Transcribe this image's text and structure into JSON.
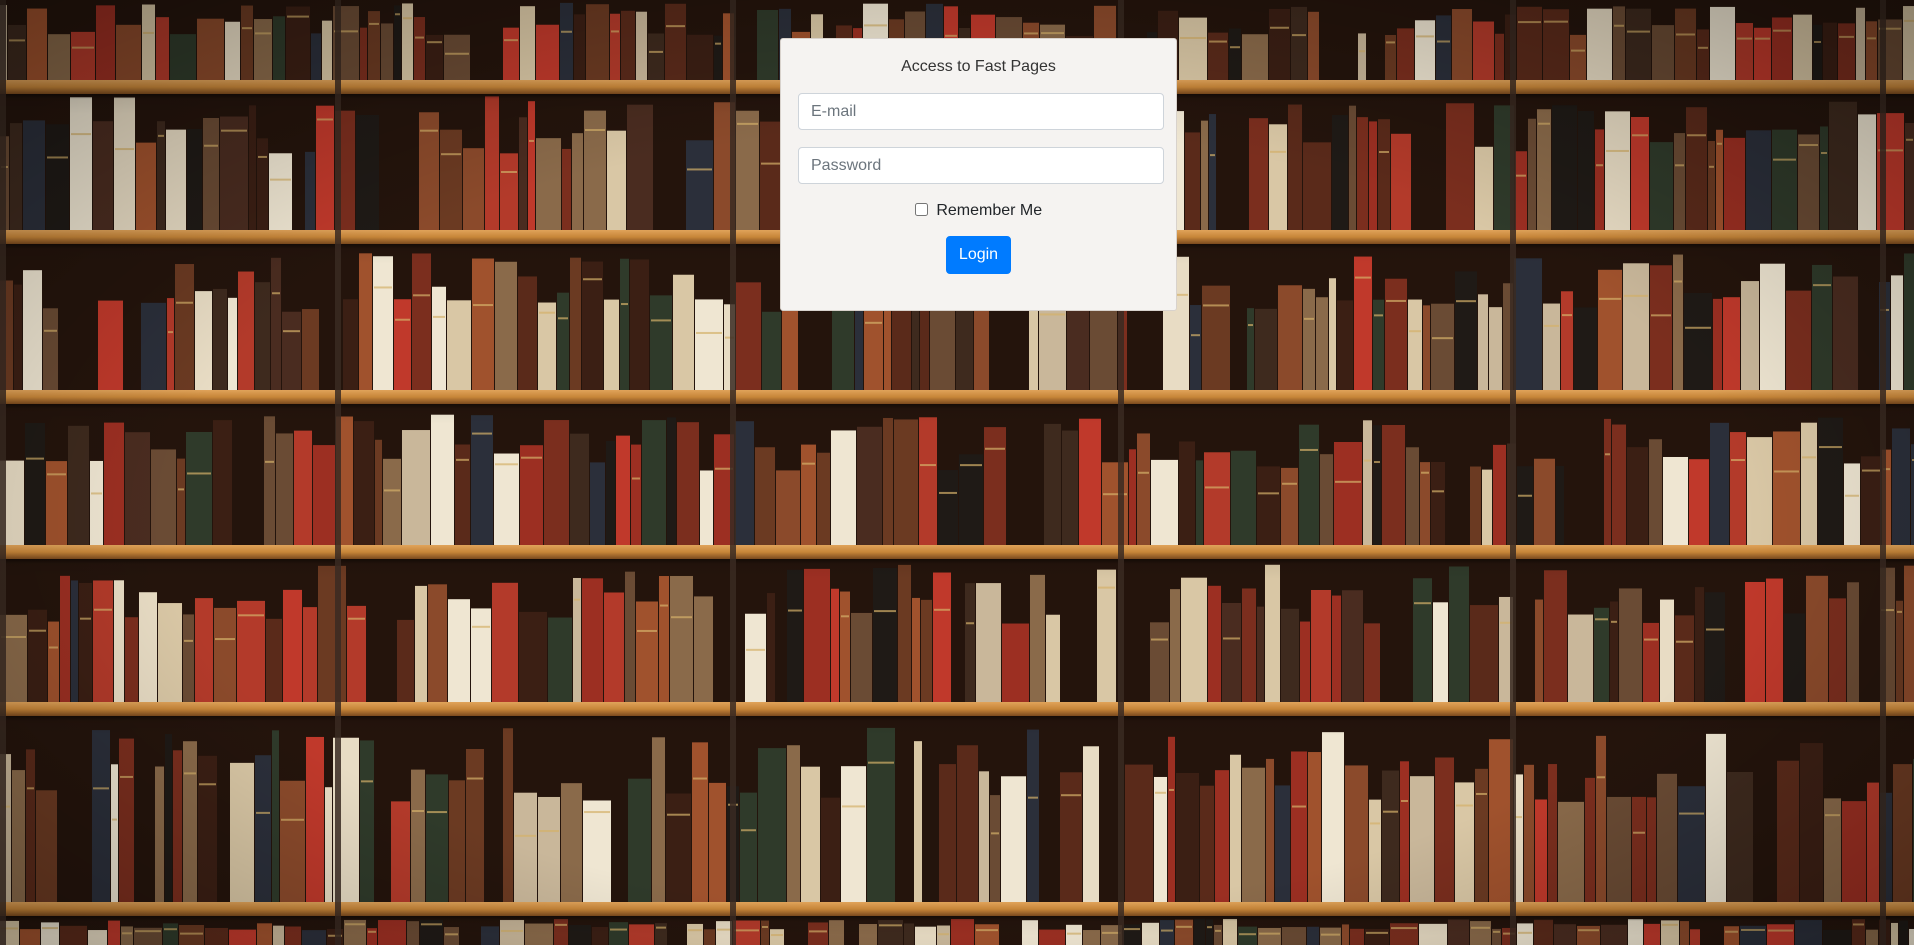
{
  "login": {
    "title": "Access to Fast Pages",
    "email_placeholder": "E-mail",
    "email_value": "",
    "password_placeholder": "Password",
    "password_value": "",
    "remember_label": "Remember Me",
    "remember_checked": false,
    "submit_label": "Login"
  },
  "colors": {
    "accent": "#007bff",
    "card_background": "#f5f3f1",
    "shelf_wood": "#c98a3c"
  },
  "background": {
    "description_icon": "bookshelf-background-image"
  }
}
